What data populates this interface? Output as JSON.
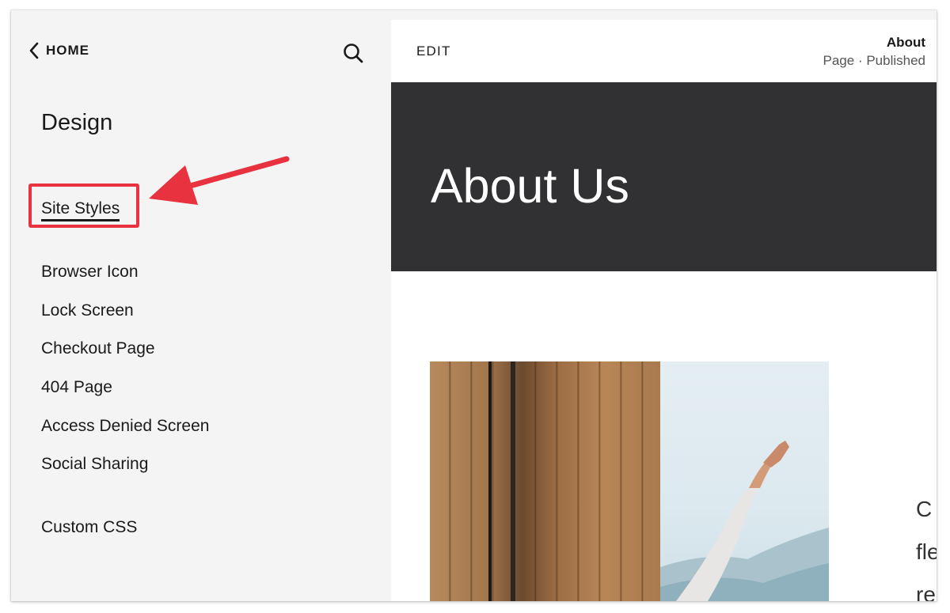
{
  "sidebar": {
    "home_label": "HOME",
    "title": "Design",
    "items": [
      {
        "label": "Site Styles",
        "active": true
      },
      {
        "label": "Browser Icon"
      },
      {
        "label": "Lock Screen"
      },
      {
        "label": "Checkout Page"
      },
      {
        "label": "404 Page"
      },
      {
        "label": "Access Denied Screen"
      },
      {
        "label": "Social Sharing"
      },
      {
        "label": "Custom CSS"
      }
    ]
  },
  "preview": {
    "edit_label": "EDIT",
    "page_name": "About",
    "page_status": "Page · Published",
    "hero_title": "About Us",
    "side_text": [
      "C",
      "fle",
      "re"
    ]
  },
  "colors": {
    "sidebar_bg": "#f4f4f4",
    "hero_bg": "#313133",
    "highlight": "#e8323f"
  }
}
